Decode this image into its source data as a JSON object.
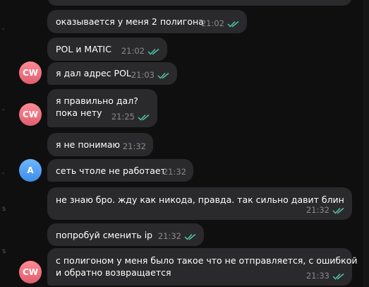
{
  "colors": {
    "bubble": "#2a2a2c",
    "read_ticks": "#4fc3a1",
    "avatar_cw": "#e96b7a",
    "avatar_a": "#4a9ef0"
  },
  "messages": [
    {
      "text": "оказывается у меня 2 полигона",
      "time": "21:02"
    },
    {
      "text": "POL и MATIC",
      "time": "21:02"
    },
    {
      "text": "я дал адрес POL",
      "time": "21:03",
      "avatar": "CW"
    },
    {
      "text_line1": "я правильно дал?",
      "text_line2": "пока нету",
      "time": "21:25",
      "avatar": "CW"
    },
    {
      "text": "я не понимаю",
      "time": "21:32"
    },
    {
      "text": "сеть чтоле не работает",
      "time": "21:32",
      "avatar": "A"
    },
    {
      "text": "не знаю бро. жду как никода, правда. так сильно давит блин",
      "time": "21:32"
    },
    {
      "text": "попробуй сменить ip",
      "time": "21:32"
    },
    {
      "text_line1": "с полигоном у меня было такое что не отправляется, с ошибкой",
      "text_line2": "и обратно возвращается",
      "time": "21:33",
      "avatar": "CW"
    }
  ]
}
